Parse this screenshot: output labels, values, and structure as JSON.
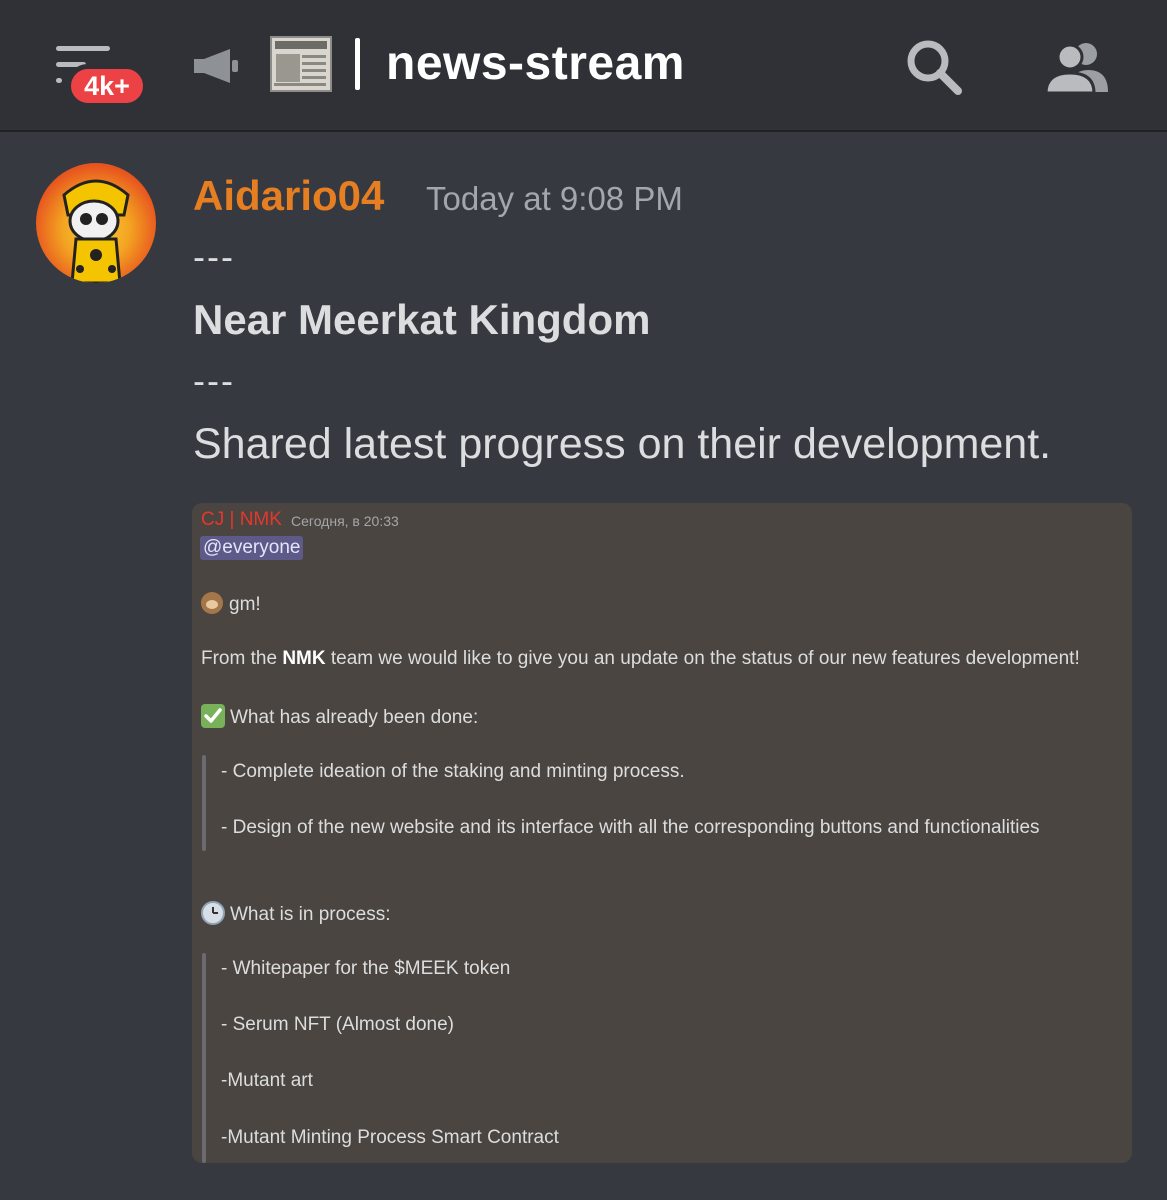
{
  "header": {
    "unread_badge": "4k+",
    "channel_name": "news-stream",
    "icons": [
      "menu-icon",
      "megaphone-icon",
      "newspaper-icon",
      "search-icon",
      "members-icon"
    ]
  },
  "message": {
    "username": "Aidario04",
    "username_color": "#e67e22",
    "timestamp": "Today at 9:08 PM",
    "separator_top": "---",
    "headline": "Near Meerkat Kingdom",
    "separator_bottom": "---",
    "body": "Shared latest progress on their development."
  },
  "embed": {
    "author": "CJ | NMK",
    "author_color": "#e6372c",
    "time": "Сегодня, в 20:33",
    "mention": "@everyone",
    "greeting": "gm!",
    "intro_prefix": "From the ",
    "intro_bold": "NMK",
    "intro_suffix": " team we would like to give you an update on the status of our new features development!",
    "done_title": "What has already been done:",
    "done_items": [
      "- Complete ideation of the staking and minting process.",
      "- Design of the new website and its interface with all the corresponding buttons and functionalities"
    ],
    "process_title": "What is in process:",
    "process_items": [
      "- Whitepaper for the $MEEK token",
      "- Serum NFT (Almost done)",
      "-Mutant art",
      "-Mutant Minting Process Smart Contract"
    ]
  }
}
